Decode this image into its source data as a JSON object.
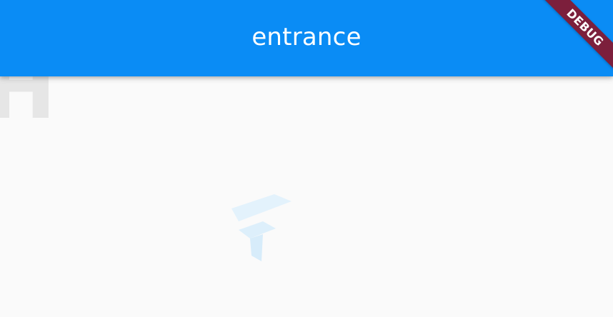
{
  "app_bar": {
    "title": "entrance",
    "color": "#0a8cf5"
  },
  "background": {
    "watermark_letter": "H",
    "logo_icon": "flutter-logo-icon",
    "color": "#fafafa"
  },
  "debug_banner": {
    "label": "DEBUG",
    "color": "#7c1f3c"
  }
}
